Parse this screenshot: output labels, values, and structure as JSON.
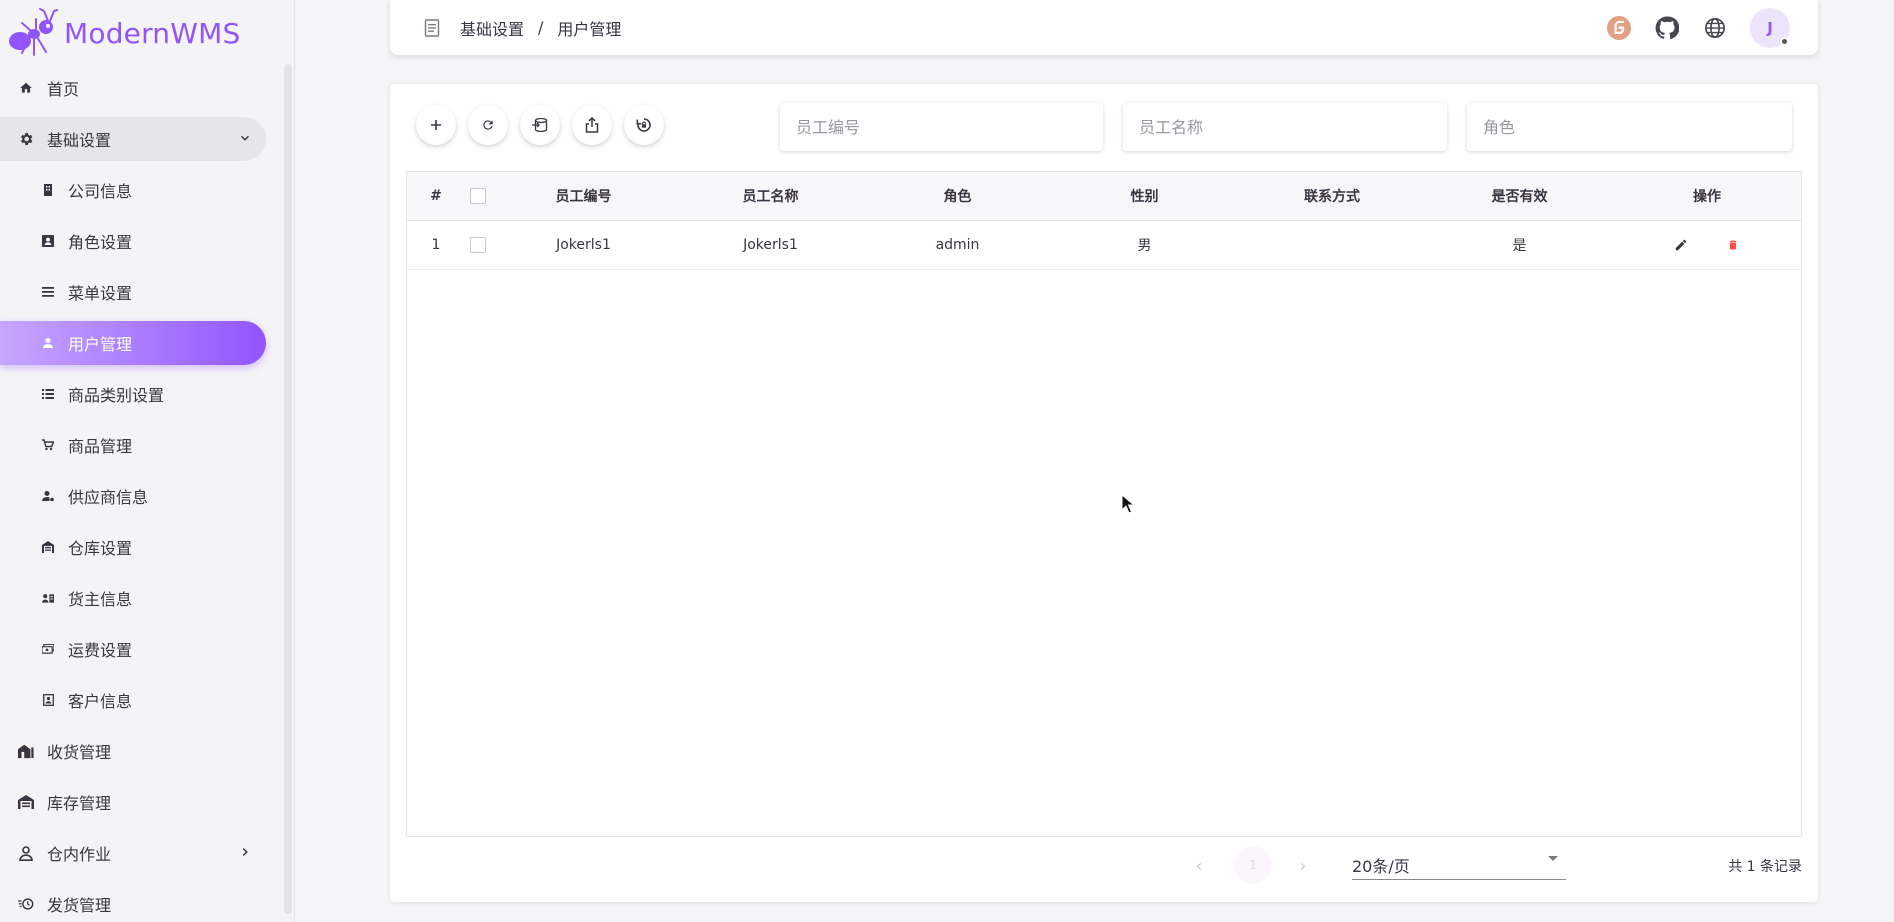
{
  "app": {
    "name": "ModernWMS",
    "brand_color": "#9155fd"
  },
  "sidebar": {
    "items": [
      {
        "label": "首页",
        "icon": "home-icon"
      },
      {
        "label": "基础设置",
        "icon": "gear-icon",
        "expanded": true
      },
      {
        "label": "公司信息",
        "icon": "building-icon"
      },
      {
        "label": "角色设置",
        "icon": "badge-icon"
      },
      {
        "label": "菜单设置",
        "icon": "menu-icon"
      },
      {
        "label": "用户管理",
        "icon": "person-icon",
        "active": true
      },
      {
        "label": "商品类别设置",
        "icon": "list-icon"
      },
      {
        "label": "商品管理",
        "icon": "cart-icon"
      },
      {
        "label": "供应商信息",
        "icon": "person-gear-icon"
      },
      {
        "label": "仓库设置",
        "icon": "warehouse-icon"
      },
      {
        "label": "货主信息",
        "icon": "id-card-icon"
      },
      {
        "label": "运费设置",
        "icon": "cash-icon"
      },
      {
        "label": "客户信息",
        "icon": "contact-icon"
      },
      {
        "label": "收货管理",
        "icon": "home-receive-icon"
      },
      {
        "label": "库存管理",
        "icon": "warehouse-stock-icon"
      },
      {
        "label": "仓内作业",
        "icon": "worker-icon",
        "collapsed": true
      },
      {
        "label": "发货管理",
        "icon": "delivery-icon"
      }
    ]
  },
  "header": {
    "breadcrumb": [
      "基础设置",
      "用户管理"
    ],
    "separator": "/",
    "avatar_initial": "J",
    "icons": [
      "gitee-icon",
      "github-icon",
      "globe-icon"
    ]
  },
  "toolbar": {
    "buttons": [
      "add-icon",
      "refresh-icon",
      "import-icon",
      "export-icon",
      "reset-password-icon"
    ]
  },
  "filters": {
    "user_code_placeholder": "员工编号",
    "user_name_placeholder": "员工名称",
    "role_placeholder": "角色"
  },
  "table": {
    "columns": [
      "#",
      "",
      "员工编号",
      "员工名称",
      "角色",
      "性别",
      "联系方式",
      "是否有效",
      "操作"
    ],
    "rows": [
      {
        "index": "1",
        "user_num": "Jokerls1",
        "user_name": "Jokerls1",
        "role": "admin",
        "sex": "男",
        "contact": "",
        "is_valid": "是"
      }
    ]
  },
  "pagination": {
    "current_page": "1",
    "page_size": "20条/页",
    "total": "共 1 条记录"
  }
}
